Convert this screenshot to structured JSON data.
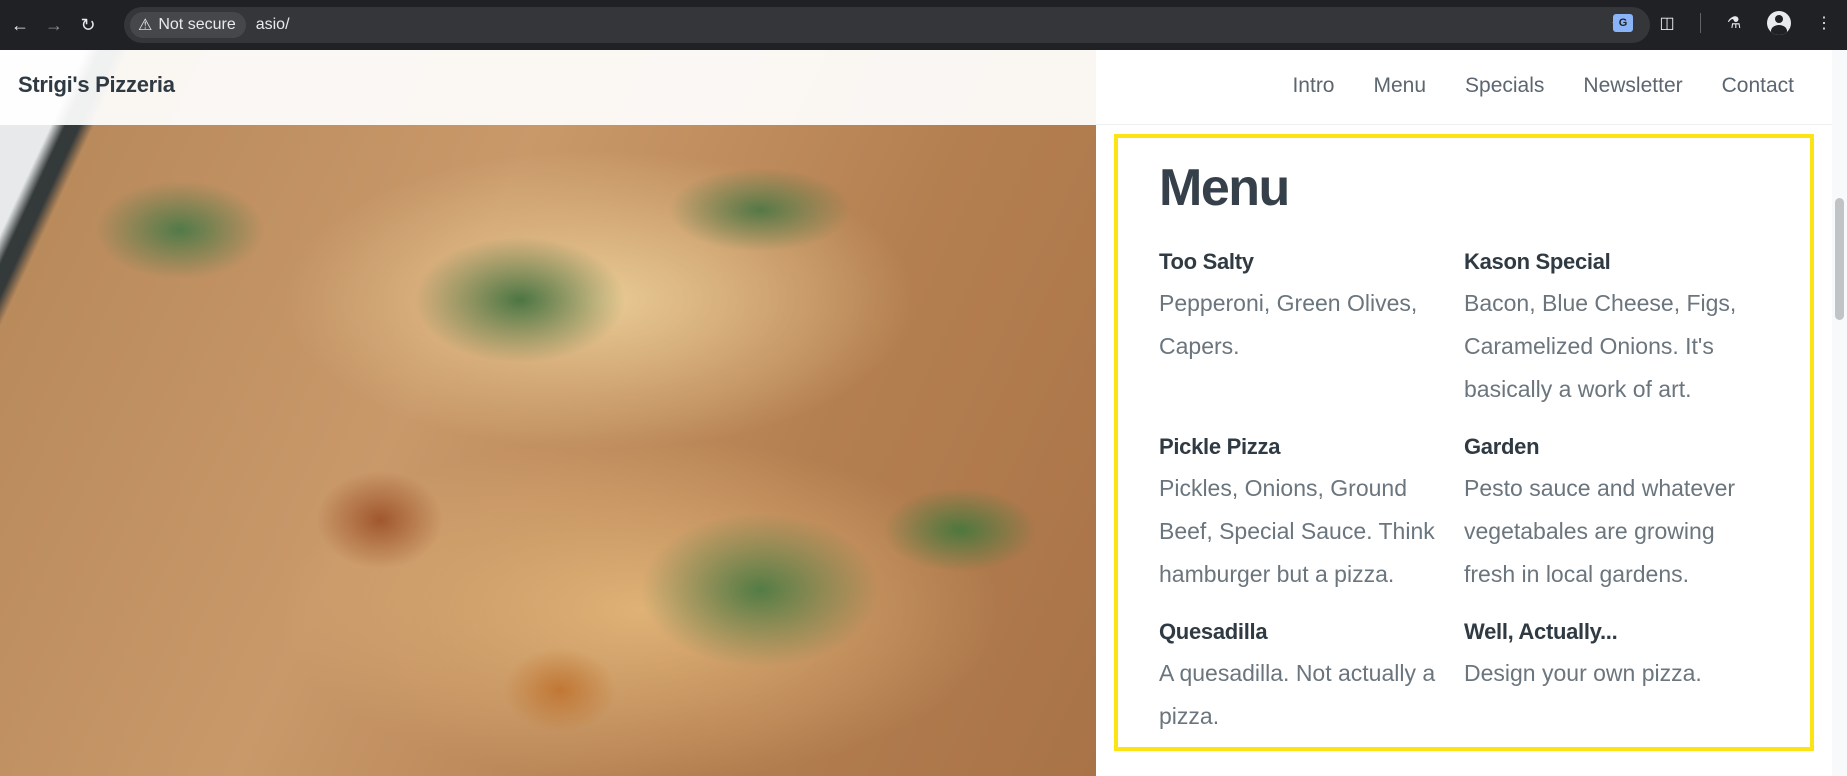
{
  "browser": {
    "security_label": "Not secure",
    "url": "asio/",
    "back_icon": "back-arrow-icon",
    "forward_icon": "forward-arrow-icon",
    "reload_icon": "reload-icon"
  },
  "site": {
    "brand": "Strigi's Pizzeria",
    "nav": [
      "Intro",
      "Menu",
      "Specials",
      "Newsletter",
      "Contact"
    ]
  },
  "menu": {
    "title": "Menu",
    "items": [
      {
        "name": "Too Salty",
        "desc": "Pepperoni, Green Olives, Capers."
      },
      {
        "name": "Kason Special",
        "desc": "Bacon, Blue Cheese, Figs, Caramelized Onions. It's basically a work of art."
      },
      {
        "name": "Pickle Pizza",
        "desc": "Pickles, Onions, Ground Beef, Special Sauce. Think hamburger but a pizza."
      },
      {
        "name": "Garden",
        "desc": "Pesto sauce and whatever vegetabales are growing fresh in local gardens."
      },
      {
        "name": "Quesadilla",
        "desc": "A quesadilla. Not actually a pizza."
      },
      {
        "name": "Well, Actually...",
        "desc": "Design your own pizza."
      }
    ],
    "highlight_color": "#fbe316"
  }
}
